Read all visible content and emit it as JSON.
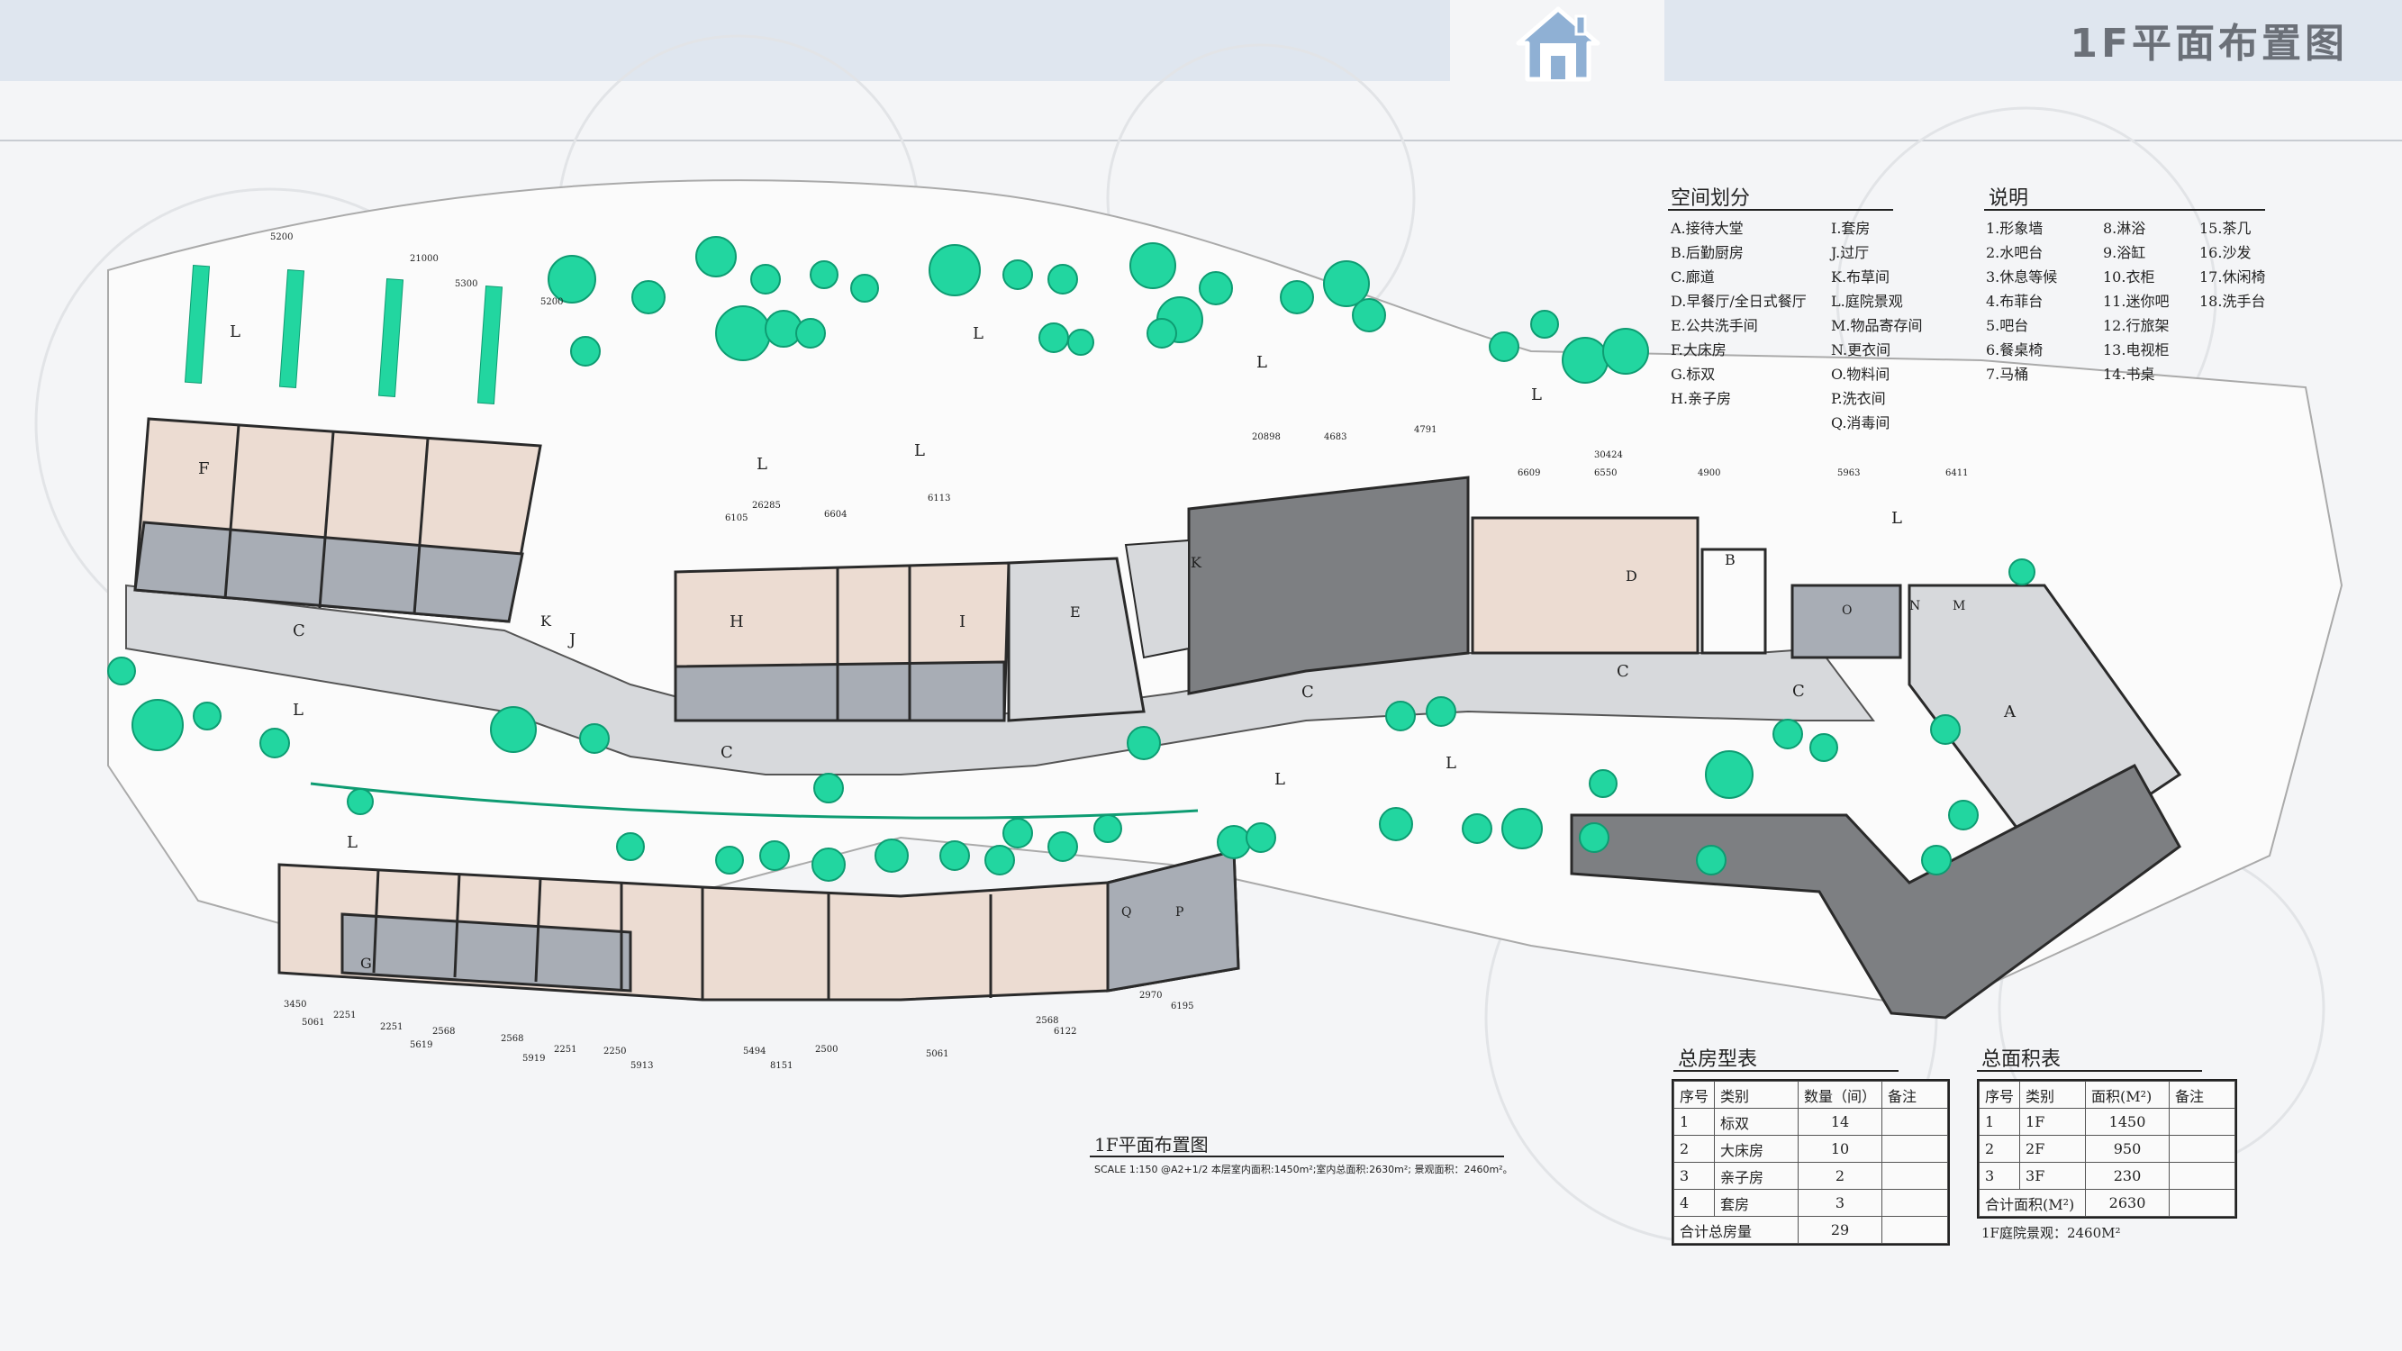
{
  "header": {
    "title": "1F平面布置图",
    "icon": "house-icon"
  },
  "legend_space": {
    "title": "空间划分",
    "items_left": [
      "A.接待大堂",
      "B.后勤厨房",
      "C.廊道",
      "D.早餐厅/全日式餐厅",
      "E.公共洗手间",
      "F.大床房",
      "G.标双",
      "H.亲子房"
    ],
    "items_right": [
      "I.套房",
      "J.过厅",
      "K.布草间",
      "L.庭院景观",
      "M.物品寄存间",
      "N.更衣间",
      "O.物料间",
      "P.洗衣间",
      "Q.消毒间"
    ]
  },
  "legend_notes": {
    "title": "说明",
    "col1": [
      "1.形象墙",
      "2.水吧台",
      "3.休息等候",
      "4.布菲台",
      "5.吧台",
      "6.餐桌椅",
      "7.马桶"
    ],
    "col2": [
      "8.淋浴",
      "9.浴缸",
      "10.衣柜",
      "11.迷你吧",
      "12.行旅架",
      "13.电视柜",
      "14.书桌"
    ],
    "col3": [
      "15.茶几",
      "16.沙发",
      "17.休闲椅",
      "18.洗手台"
    ]
  },
  "room_table": {
    "title": "总房型表",
    "headers": [
      "序号",
      "类别",
      "数量（间）",
      "备注"
    ],
    "rows": [
      [
        "1",
        "标双",
        "14",
        ""
      ],
      [
        "2",
        "大床房",
        "10",
        ""
      ],
      [
        "3",
        "亲子房",
        "2",
        ""
      ],
      [
        "4",
        "套房",
        "3",
        ""
      ]
    ],
    "total_label": "合计总房量",
    "total_value": "29"
  },
  "area_table": {
    "title": "总面积表",
    "headers": [
      "序号",
      "类别",
      "面积(M²)",
      "备注"
    ],
    "rows": [
      [
        "1",
        "1F",
        "1450",
        ""
      ],
      [
        "2",
        "2F",
        "950",
        ""
      ],
      [
        "3",
        "3F",
        "230",
        ""
      ]
    ],
    "total_label": "合计面积(M²)",
    "total_value": "2630",
    "footnote": "1F庭院景观：2460M²"
  },
  "plan": {
    "caption": "1F平面布置图",
    "scale_note": "SCALE  1:150  @A2+1/2    本层室内面积:1450m²;室内总面积:2630m²;  景观面积：2460m²。",
    "zone_letters": [
      "L",
      "L",
      "L",
      "L",
      "L",
      "L",
      "L",
      "L",
      "L",
      "L",
      "L",
      "A",
      "B",
      "C",
      "C",
      "C",
      "C",
      "C",
      "D",
      "E",
      "F",
      "G",
      "H",
      "I",
      "J",
      "K",
      "K",
      "M",
      "N",
      "O",
      "P",
      "Q"
    ],
    "dims_top": [
      "5200",
      "21000",
      "5300",
      "5200",
      "30424",
      "6609",
      "6550",
      "4900",
      "5963",
      "6411",
      "26285",
      "6105",
      "6604",
      "6113",
      "4683",
      "4791",
      "20898"
    ],
    "dims_bottom": [
      "3450",
      "5061",
      "2251",
      "2251",
      "2568",
      "5619",
      "2568",
      "2251",
      "2250",
      "5919",
      "5913",
      "5494",
      "2500",
      "8151",
      "5061",
      "2568",
      "6122",
      "2970",
      "6195"
    ],
    "colors": {
      "trees": "#22d6a0",
      "tree_stroke": "#0e9c72",
      "core": "#7d7f82",
      "room_warm": "#ecdcd2",
      "bath": "#a8adb5",
      "corridor": "#d7d9dc",
      "wall": "#2a2a2a",
      "court": "#f2f3f4"
    }
  }
}
